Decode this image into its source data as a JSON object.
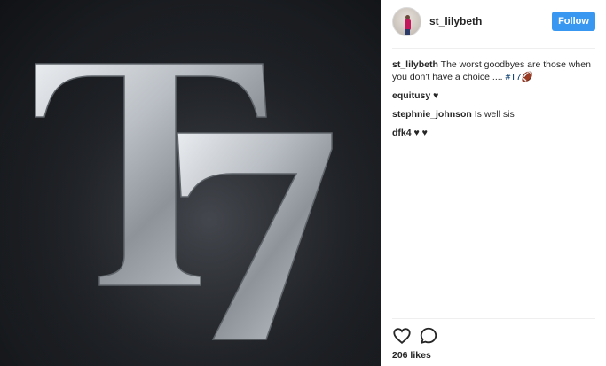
{
  "post": {
    "image": {
      "letters": "T7"
    }
  },
  "header": {
    "username": "st_lilybeth",
    "follow_label": "Follow"
  },
  "comments": [
    {
      "user": "st_lilybeth",
      "text": "The worst goodbyes are those when you don't have a choice .... ",
      "tag": "#T7🏈"
    },
    {
      "user": "equitusy",
      "text": "♥"
    },
    {
      "user": "stephnie_johnson",
      "text": "Is well sis"
    },
    {
      "user": "dfk4",
      "text": "♥ ♥"
    }
  ],
  "actions": {
    "like_icon": "heart-icon",
    "comment_icon": "speech-bubble-icon",
    "likes_text": "206 likes"
  },
  "colors": {
    "follow_button": "#3897f0",
    "hashtag": "#003569",
    "divider": "#efefef"
  }
}
